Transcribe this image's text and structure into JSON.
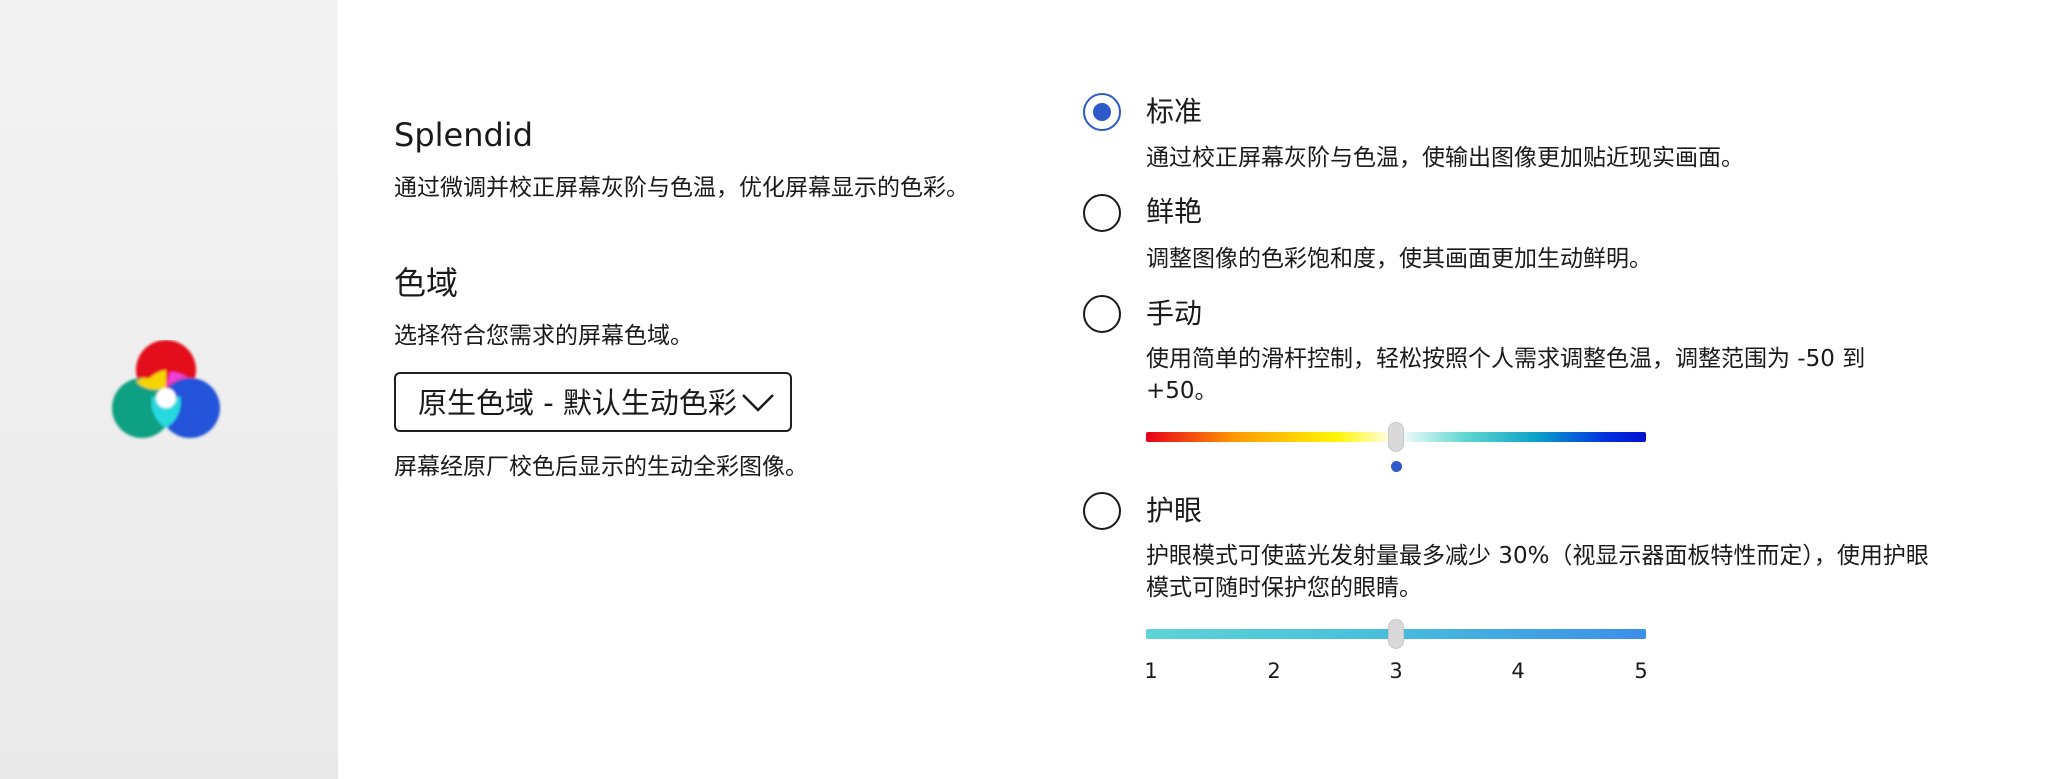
{
  "splendid": {
    "title": "Splendid",
    "description": "通过微调并校正屏幕灰阶与色温，优化屏幕显示的色彩。"
  },
  "gamut": {
    "title": "色域",
    "description": "选择符合您需求的屏幕色域。",
    "selected": "原生色域 - 默认生动色彩",
    "selected_description": "屏幕经原厂校色后显示的生动全彩图像。"
  },
  "modes": [
    {
      "label": "标准",
      "description": "通过校正屏幕灰阶与色温，使输出图像更加贴近现实画面。",
      "checked": true
    },
    {
      "label": "鲜艳",
      "description": "调整图像的色彩饱和度，使其画面更加生动鲜明。",
      "checked": false
    },
    {
      "label": "手动",
      "description": "使用简单的滑杆控制，轻松按照个人需求调整色温，调整范围为 -50 到 +50。",
      "checked": false
    },
    {
      "label": "护眼",
      "description": "护眼模式可使蓝光发射量最多减少 30%（视显示器面板特性而定），使用护眼模式可随时保护您的眼睛。",
      "checked": false
    }
  ],
  "color_temp_slider": {
    "min": -50,
    "max": 50,
    "value": 0
  },
  "eye_care_slider": {
    "ticks": [
      "1",
      "2",
      "3",
      "4",
      "5"
    ],
    "value": 3
  },
  "icons": [
    "rgb-color-icon",
    "chevron-down-icon"
  ],
  "colors": {
    "accent": "#2e59c8"
  }
}
